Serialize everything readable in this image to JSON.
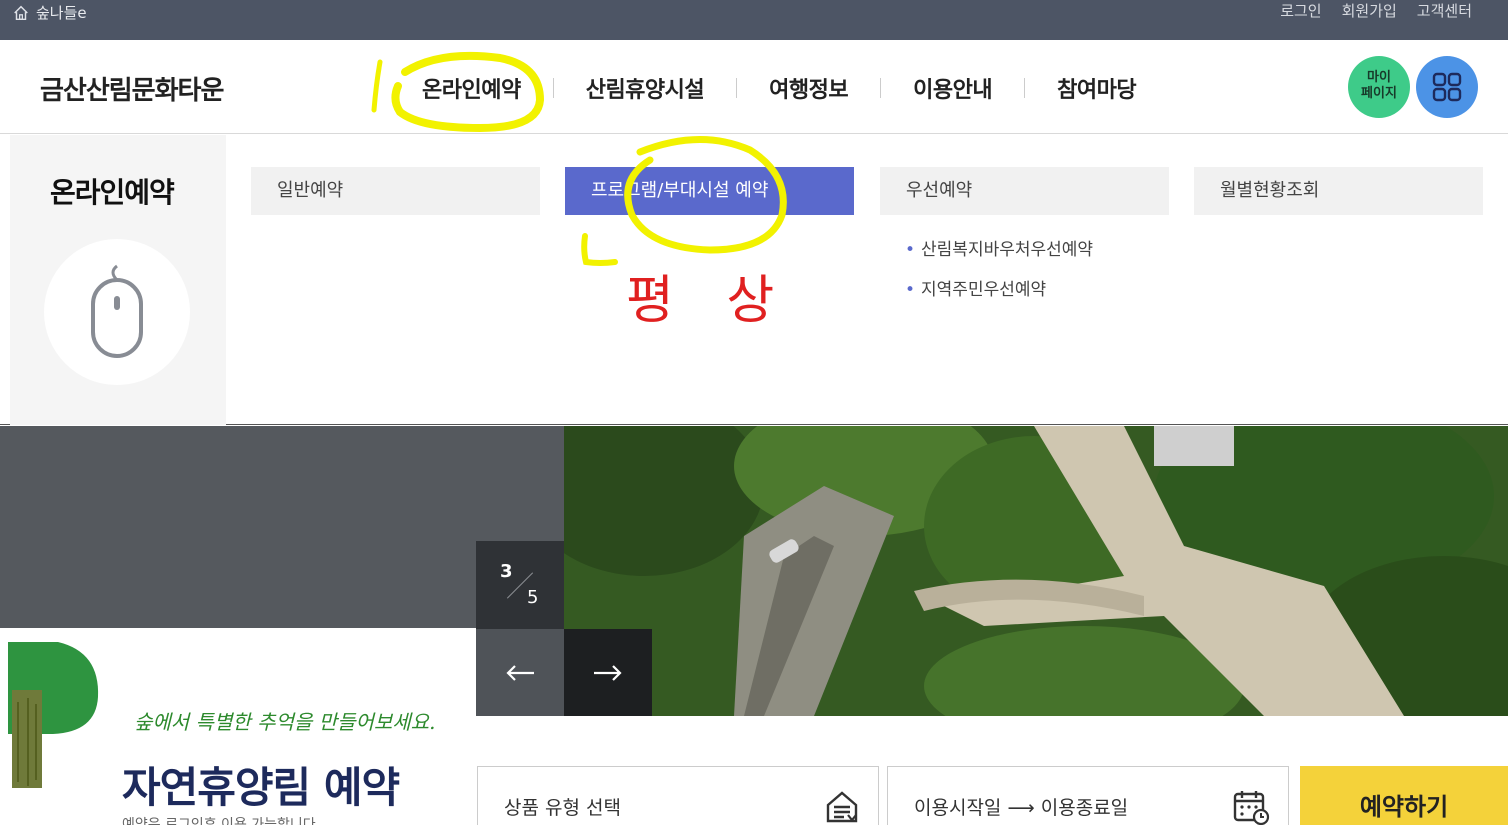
{
  "topbar": {
    "home_label": "숲나들e",
    "links": [
      "로그인",
      "회원가입",
      "고객센터"
    ]
  },
  "header": {
    "site_title": "금산산림문화타운",
    "nav": [
      "온라인예약",
      "산림휴양시설",
      "여행정보",
      "이용안내",
      "참여마당"
    ],
    "mypage_line1": "마이",
    "mypage_line2": "페이지"
  },
  "mega_menu": {
    "title": "온라인예약",
    "boxes": [
      "일반예약",
      "프로그램/부대시설 예약",
      "우선예약",
      "월별현황조회"
    ],
    "active_box": "프로그램/부대시설 예약",
    "sub_items": [
      "산림복지바우처우선예약",
      "지역주민우선예약"
    ]
  },
  "annotations": {
    "number": "1",
    "note": "평 상"
  },
  "slider": {
    "current": "3",
    "total": "5"
  },
  "promo": {
    "tagline": "숲에서 특별한 추억을 만들어보세요.",
    "title": "자연휴양림 예약",
    "subtitle": "예약은 로그인후 이용 가능합니다."
  },
  "search": {
    "product_type": "상품 유형 선택",
    "date_start": "이용시작일",
    "date_arrow": "⟶",
    "date_end": "이용종료일",
    "reserve_button": "예약하기"
  },
  "colors": {
    "topbar": "#4d5565",
    "active_menu": "#5a69cc",
    "mypage": "#3ecb89",
    "allmenu": "#4c93e6",
    "reserve": "#f4d23a",
    "highlighter": "#f2f200",
    "pen": "#e02020"
  }
}
